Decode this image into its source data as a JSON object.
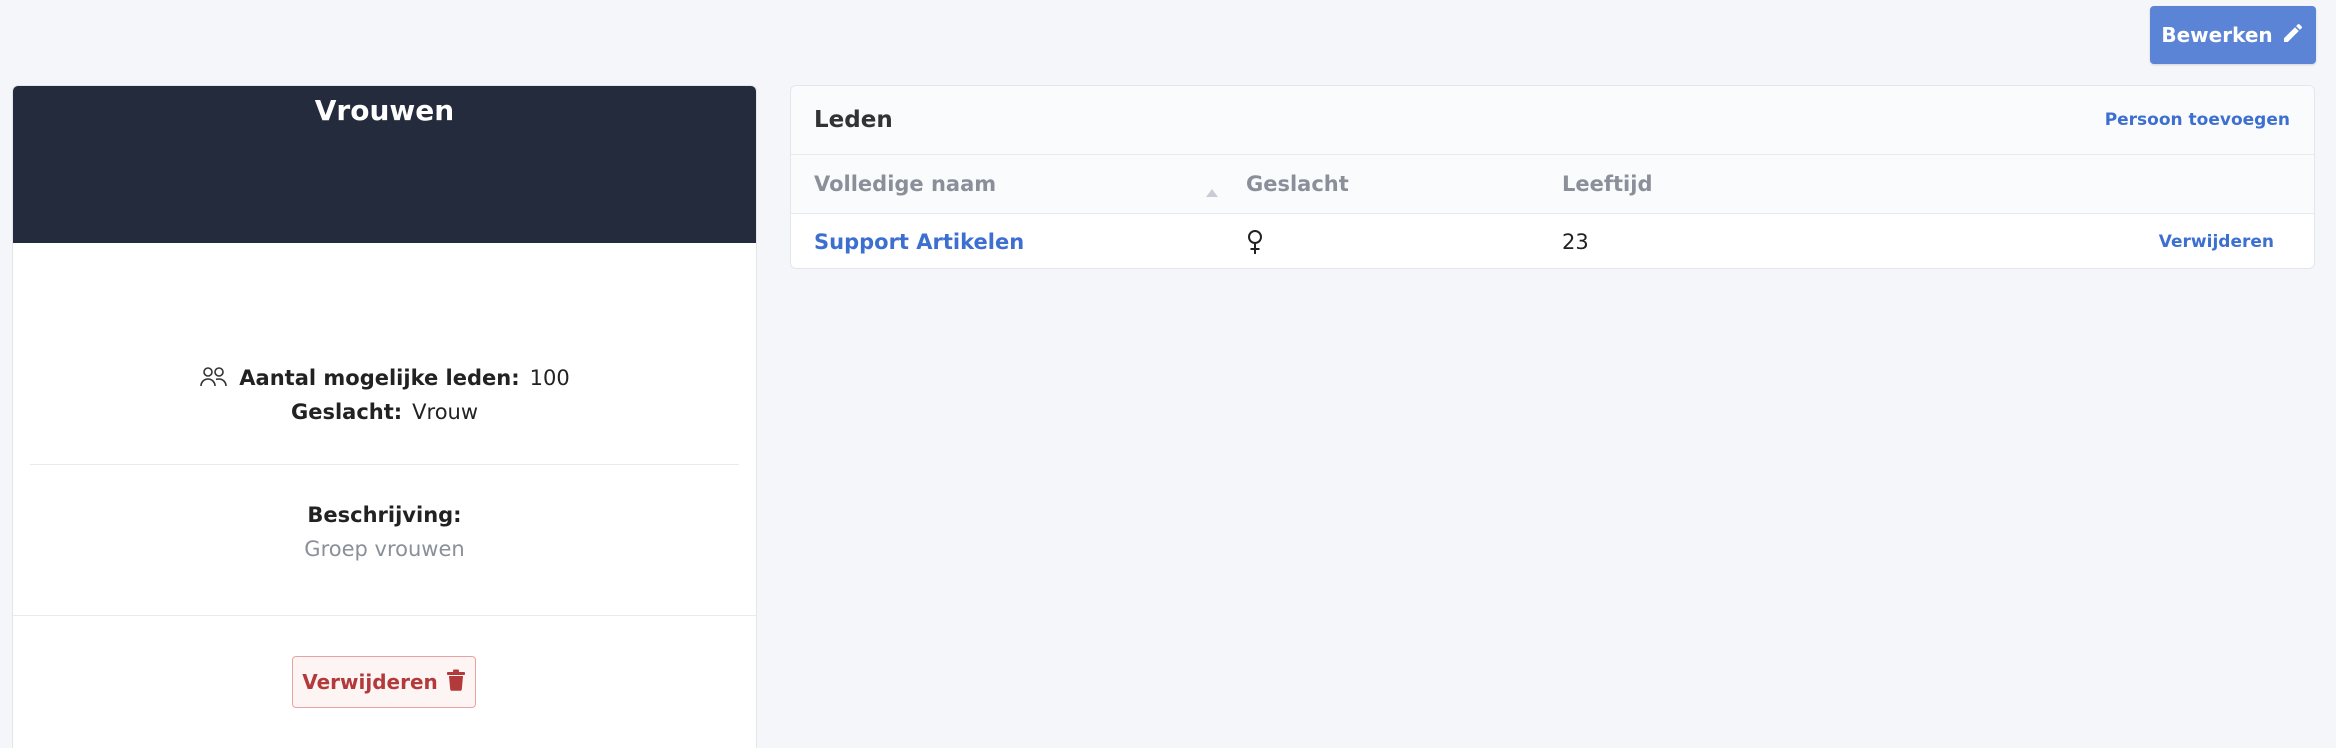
{
  "toolbar": {
    "edit_label": "Bewerken",
    "edit_icon": "pencil-icon"
  },
  "group": {
    "title": "Vrouwen",
    "max_members_label": "Aantal mogelijke leden:",
    "max_members_value": "100",
    "gender_label": "Geslacht:",
    "gender_value": "Vrouw",
    "description_label": "Beschrijving:",
    "description_value": "Groep vrouwen",
    "delete_label": "Verwijderen",
    "delete_icon": "trash-icon",
    "members_icon": "users-icon"
  },
  "members": {
    "title": "Leden",
    "add_label": "Persoon toevoegen",
    "columns": [
      "Volledige naam",
      "Geslacht",
      "Leeftijd"
    ],
    "rows": [
      {
        "name": "Support Artikelen",
        "gender_icon": "female-icon",
        "age": "23",
        "action": "Verwijderen"
      }
    ]
  },
  "colors": {
    "primary": "#5b84d6",
    "link": "#3d6fd1",
    "header_dark": "#242b3c",
    "danger": "#b33a3a",
    "background": "#f5f6fa"
  }
}
